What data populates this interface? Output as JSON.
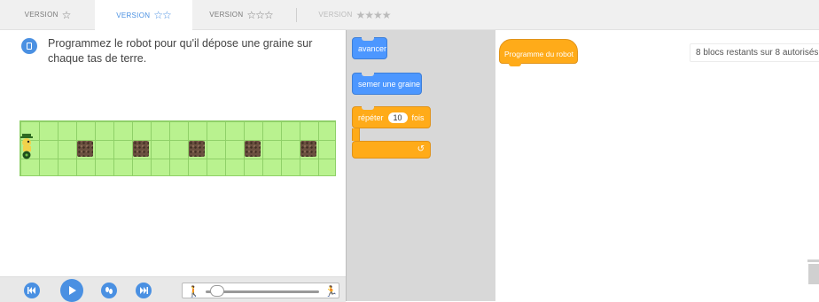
{
  "tabs": [
    {
      "label": "VERSION",
      "stars": "☆",
      "state": "normal"
    },
    {
      "label": "VERSION",
      "stars": "☆☆",
      "state": "active"
    },
    {
      "label": "VERSION",
      "stars": "☆☆☆",
      "state": "normal"
    },
    {
      "label": "VERSION",
      "stars": "★★★★",
      "state": "disabled"
    }
  ],
  "instructions": {
    "icon": "book-icon",
    "text": "Programmez le robot pour qu'il dépose une graine sur chaque tas de terre."
  },
  "grid": {
    "rows": 3,
    "cols": 17,
    "robot_cell": {
      "row": 1,
      "col": 0
    },
    "dirt_cells": [
      {
        "row": 1,
        "col": 3
      },
      {
        "row": 1,
        "col": 6
      },
      {
        "row": 1,
        "col": 9
      },
      {
        "row": 1,
        "col": 12
      },
      {
        "row": 1,
        "col": 15
      }
    ]
  },
  "controls": {
    "buttons": [
      "rewind-icon",
      "play-icon",
      "step-icon",
      "fast-forward-icon"
    ],
    "speed_slow_icon": "walk-icon",
    "speed_fast_icon": "run-icon",
    "speed_value": 0.1
  },
  "palette": {
    "blocks": [
      {
        "id": "avancer",
        "label": "avancer",
        "category": "motion"
      },
      {
        "id": "semer",
        "label": "semer une graine",
        "category": "motion"
      },
      {
        "id": "repeter",
        "label": "répéter",
        "value": "10",
        "suffix": "fois",
        "category": "control"
      }
    ]
  },
  "workspace": {
    "program_block": "Programme du robot",
    "remaining": "8 blocs restants sur 8 autorisés."
  },
  "colors": {
    "accent": "#4a90e2",
    "motion": "#4c97ff",
    "control": "#ffab19",
    "grass": "#b9f28f"
  }
}
